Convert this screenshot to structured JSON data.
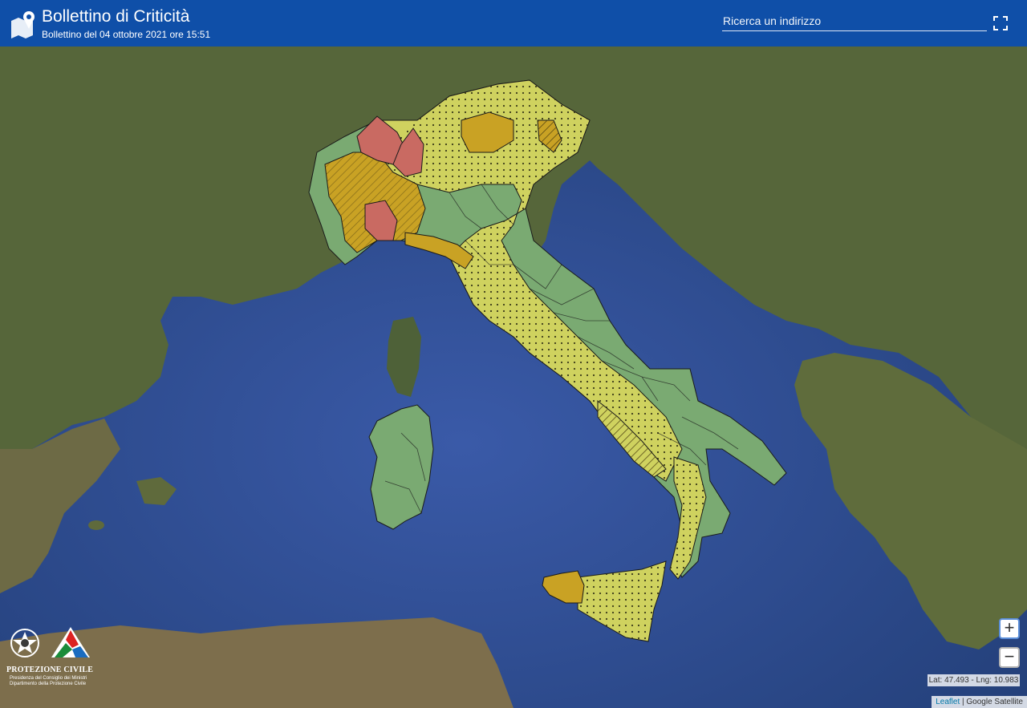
{
  "header": {
    "title": "Bollettino di Criticità",
    "subtitle": "Bollettino del 04 ottobre 2021 ore 15:51",
    "logo_icon": "map-pin-icon",
    "fullscreen_icon": "fullscreen-icon"
  },
  "search": {
    "placeholder": "Ricerca un indirizzo"
  },
  "map": {
    "zoom_in_label": "+",
    "zoom_out_label": "−",
    "coordinates": "Lat: 47.493 - Lng: 10.983",
    "attribution_leaflet": "Leaflet",
    "attribution_separator": " | ",
    "attribution_provider": "Google Satellite",
    "colors": {
      "sea": "#2f4f8f",
      "land": "#5e6b3a",
      "green_zone": "#7aaa72",
      "yellow_zone": "#cfd25f",
      "orange_zone": "#c9a224",
      "red_zone": "#c96a62"
    }
  },
  "brand": {
    "name": "PROTEZIONE CIVILE",
    "line1": "Presidenza del Consiglio dei Ministri",
    "line2": "Dipartimento della Protezione Civile"
  }
}
